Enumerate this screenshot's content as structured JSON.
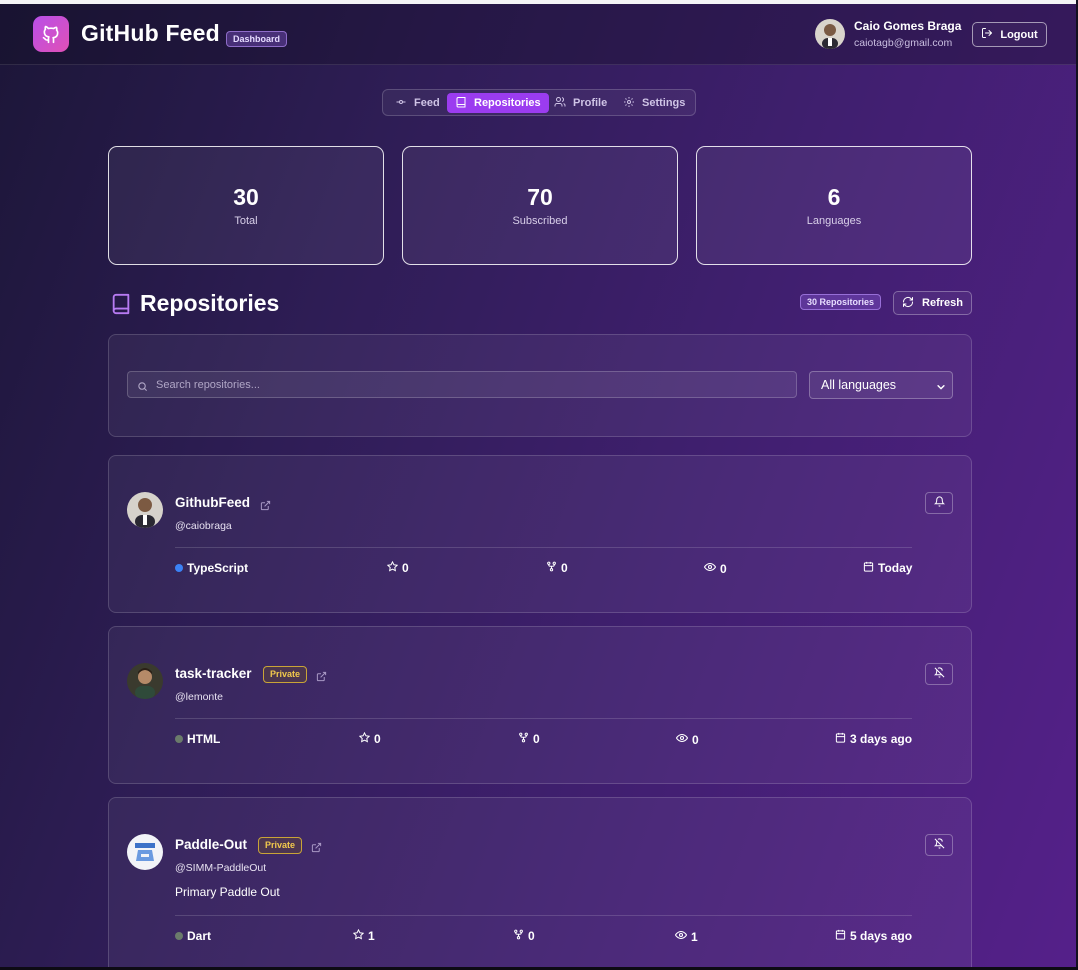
{
  "header": {
    "app_title": "GitHub Feed",
    "badge": "Dashboard",
    "user_name": "Caio Gomes Braga",
    "user_email": "caiotagb@gmail.com",
    "logout_label": "Logout"
  },
  "tabs": [
    {
      "label": "Feed",
      "icon": "commit-icon",
      "active": false
    },
    {
      "label": "Repositories",
      "icon": "book-icon",
      "active": true
    },
    {
      "label": "Profile",
      "icon": "users-icon",
      "active": false
    },
    {
      "label": "Settings",
      "icon": "gear-icon",
      "active": false
    }
  ],
  "stats": [
    {
      "value": "30",
      "label": "Total"
    },
    {
      "value": "70",
      "label": "Subscribed"
    },
    {
      "value": "6",
      "label": "Languages"
    }
  ],
  "section": {
    "title": "Repositories",
    "count_badge": "30 Repositories",
    "refresh_label": "Refresh"
  },
  "filters": {
    "search_placeholder": "Search repositories...",
    "language_selected": "All languages"
  },
  "repos": [
    {
      "name": "GithubFeed",
      "private": false,
      "owner": "@caiobraga",
      "description": "",
      "language": "TypeScript",
      "language_color": "#3178c6",
      "stars": "0",
      "forks": "0",
      "watchers": "0",
      "updated": "Today",
      "bell": "bell-icon"
    },
    {
      "name": "task-tracker",
      "private": true,
      "private_label": "Private",
      "owner": "@lemonte",
      "description": "",
      "language": "HTML",
      "language_color": "#6b7b6b",
      "stars": "0",
      "forks": "0",
      "watchers": "0",
      "updated": "3 days ago",
      "bell": "bell-off-icon"
    },
    {
      "name": "Paddle-Out",
      "private": true,
      "private_label": "Private",
      "owner": "@SIMM-PaddleOut",
      "description": "Primary Paddle Out",
      "language": "Dart",
      "language_color": "#6b7b6b",
      "stars": "1",
      "forks": "0",
      "watchers": "1",
      "updated": "5 days ago",
      "bell": "bell-off-icon"
    }
  ],
  "colors": {
    "accent": "#9b3cf0",
    "private_badge": "#f2c94c"
  }
}
